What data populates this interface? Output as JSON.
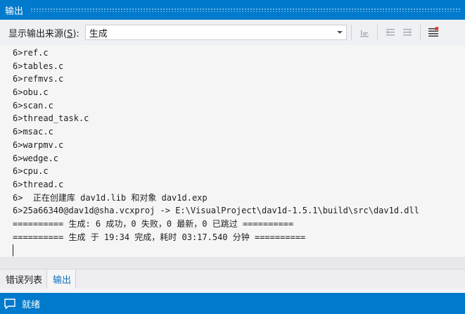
{
  "window": {
    "title": "输出"
  },
  "toolbar": {
    "source_label_prefix": "显示输出来源(",
    "source_label_key": "S",
    "source_label_suffix": "):",
    "source_value": "生成",
    "icons": [
      "find-message-icon",
      "previous-message-icon",
      "next-message-icon",
      "clear-all-icon"
    ]
  },
  "output": {
    "lines": [
      "6>ref.c",
      "6>tables.c",
      "6>refmvs.c",
      "6>obu.c",
      "6>scan.c",
      "6>thread_task.c",
      "6>msac.c",
      "6>warpmv.c",
      "6>wedge.c",
      "6>cpu.c",
      "6>thread.c",
      "6>  正在创建库 dav1d.lib 和对象 dav1d.exp",
      "6>25a66340@dav1d@sha.vcxproj -> E:\\VisualProject\\dav1d-1.5.1\\build\\src\\dav1d.dll",
      "========== 生成: 6 成功，0 失败，0 最新，0 已跳过 ==========",
      "========== 生成 于 19:34 完成，耗时 03:17.540 分钟 =========="
    ]
  },
  "tabs": [
    {
      "label": "错误列表",
      "active": false
    },
    {
      "label": "输出",
      "active": true
    }
  ],
  "status": {
    "text": "就绪",
    "icon": "notification-icon"
  },
  "colors": {
    "accent": "#007acc",
    "active_tab_text": "#0e70c0"
  }
}
